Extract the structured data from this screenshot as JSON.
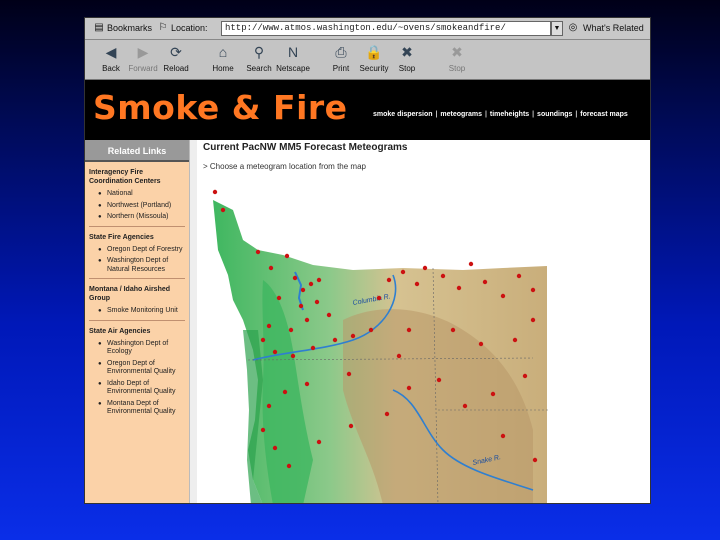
{
  "browser": {
    "bookmarks_label": "Bookmarks",
    "location_label": "Location:",
    "url": "http://www.atmos.washington.edu/~ovens/smokeandfire/",
    "whats_related_label": "What's Related",
    "nav": [
      {
        "label": "Back",
        "icon": "back-arrow-icon",
        "glyph": "◀",
        "enabled": true
      },
      {
        "label": "Forward",
        "icon": "forward-arrow-icon",
        "glyph": "▶",
        "enabled": false
      },
      {
        "label": "Reload",
        "icon": "reload-icon",
        "glyph": "⟳",
        "enabled": true
      },
      {
        "label": "Home",
        "icon": "home-icon",
        "glyph": "⌂",
        "enabled": true
      },
      {
        "label": "Search",
        "icon": "search-icon",
        "glyph": "⚲",
        "enabled": true
      },
      {
        "label": "Netscape",
        "icon": "netscape-icon",
        "glyph": "N",
        "enabled": true
      },
      {
        "label": "Print",
        "icon": "print-icon",
        "glyph": "⎙",
        "enabled": true
      },
      {
        "label": "Security",
        "icon": "lock-icon",
        "glyph": "🔒",
        "enabled": true
      },
      {
        "label": "Stop",
        "icon": "stop-icon",
        "glyph": "✖",
        "enabled": true
      },
      {
        "label": "Stop",
        "icon": "stop-icon",
        "glyph": "✖",
        "enabled": false
      }
    ]
  },
  "site": {
    "title": "Smoke & Fire",
    "nav_links": [
      "smoke dispersion",
      "meteograms",
      "timeheights",
      "soundings",
      "forecast maps"
    ]
  },
  "sidebar": {
    "title": "Related Links",
    "sections": [
      {
        "heading": "Interagency Fire Coordination Centers",
        "items": [
          "National",
          "Northwest (Portland)",
          "Northern (Missoula)"
        ]
      },
      {
        "heading": "State Fire Agencies",
        "items": [
          "Oregon Dept of Forestry",
          "Washington Dept of Natural Resources"
        ]
      },
      {
        "heading": "Montana / Idaho Airshed Group",
        "items": [
          "Smoke Monitoring Unit"
        ]
      },
      {
        "heading": "State Air Agencies",
        "items": [
          "Washington Dept of Ecology",
          "Oregon Dept of Environmental Quality",
          "Idaho Dept of Environmental Quality",
          "Montana Dept of Environmental Quality"
        ]
      }
    ]
  },
  "main": {
    "title": "Current PacNW MM5 Forecast Meteograms",
    "instruction": "> Choose a meteogram location from the map"
  },
  "map": {
    "labels": [
      "Columbia R.",
      "Snake R."
    ],
    "colors": {
      "ocean": "#ffffff",
      "lowland": "#3fb760",
      "highland": "#c9ae7b",
      "water": "#2f7fd0",
      "station": "#cc1111"
    },
    "station_count": 58
  },
  "colors": {
    "title_orange": "#ff7722",
    "sidebar_bg": "#fbd2a8",
    "page_bg": "#0018b8"
  }
}
